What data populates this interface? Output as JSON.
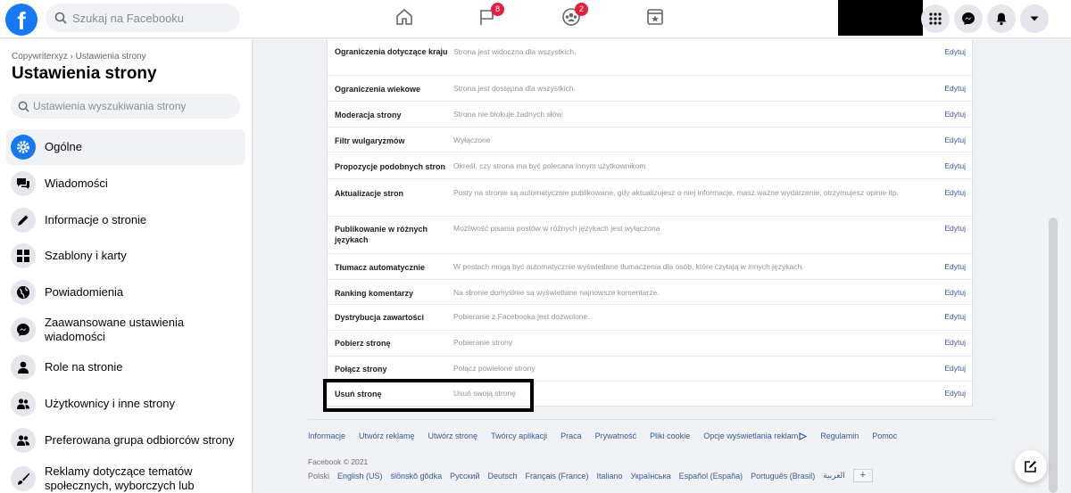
{
  "topbar": {
    "logo": "f",
    "search_placeholder": "Szukaj na Facebooku",
    "flag_badge": "8",
    "groups_badge": "2"
  },
  "sidebar": {
    "breadcrumb": "Copywriterxyz › Ustawienia strony",
    "title": "Ustawienia strony",
    "search_placeholder": "Ustawienia wyszukiwania strony",
    "items": [
      {
        "label": "Ogólne",
        "icon": "gear-icon",
        "active": true
      },
      {
        "label": "Wiadomości",
        "icon": "messages-icon"
      },
      {
        "label": "Informacje o stronie",
        "icon": "pencil-icon"
      },
      {
        "label": "Szablony i karty",
        "icon": "grid-icon"
      },
      {
        "label": "Powiadomienia",
        "icon": "globe-icon"
      },
      {
        "label": "Zaawansowane ustawienia wiadomości",
        "icon": "messenger-icon"
      },
      {
        "label": "Role na stronie",
        "icon": "person-icon"
      },
      {
        "label": "Użytkownicy i inne strony",
        "icon": "people-icon"
      },
      {
        "label": "Preferowana grupa odbiorców strony",
        "icon": "people-icon"
      },
      {
        "label": "Reklamy dotyczące tematów społecznych, wyborczych lub",
        "icon": "brush-icon"
      }
    ]
  },
  "settings": {
    "edit_label": "Edytuj",
    "rows": [
      {
        "name": "Ograniczenia dotyczące kraju",
        "desc": "Strona jest widoczna dla wszystkich."
      },
      {
        "name": "Ograniczenia wiekowe",
        "desc": "Strona jest dostępna dla wszystkich."
      },
      {
        "name": "Moderacja strony",
        "desc": "Strona nie blokuje żadnych słów."
      },
      {
        "name": "Filtr wulgaryzmów",
        "desc": "Wyłączone"
      },
      {
        "name": "Propozycje podobnych stron",
        "desc": "Określ, czy strona ma być polecana innym użytkownikom"
      },
      {
        "name": "Aktualizacje stron",
        "desc": "Posty na stronie są automatycznie publikowane, gdy aktualizujesz o niej informacje, masz ważne wydarzenie, otrzymujesz opinie itp."
      },
      {
        "name": "Publikowanie w różnych językach",
        "desc": "Możliwość pisania postów w różnych językach jest wyłączona"
      },
      {
        "name": "Tłumacz automatycznie",
        "desc": "W postach mogą być automatycznie wyświetlane tłumaczenia dla osób, które czytają w innych językach."
      },
      {
        "name": "Ranking komentarzy",
        "desc": "Na stronie domyślnie są wyświetlane najnowsze komentarze."
      },
      {
        "name": "Dystrybucja zawartości",
        "desc": "Pobieranie z Facebooka jest dozwolone."
      },
      {
        "name": "Pobierz stronę",
        "desc": "Pobieranie strony"
      },
      {
        "name": "Połącz strony",
        "desc": "Połącz powielone strony"
      },
      {
        "name": "Usuń stronę",
        "desc": "Usuń swoją stronę"
      }
    ]
  },
  "footer": {
    "links": [
      "Informacje",
      "Utwórz reklamę",
      "Utwórz stronę",
      "Twórcy aplikacji",
      "Praca",
      "Prywatność",
      "Pliki cookie",
      "Opcje wyświetlania reklam",
      "Regulamin",
      "Pomoc"
    ],
    "copyright": "Facebook © 2021",
    "current_lang": "Polski",
    "languages": [
      "English (US)",
      "ślōnskŏ gŏdka",
      "Русский",
      "Deutsch",
      "Français (France)",
      "Italiano",
      "Українська",
      "Español (España)",
      "Português (Brasil)",
      "العربية"
    ],
    "more": "+"
  }
}
